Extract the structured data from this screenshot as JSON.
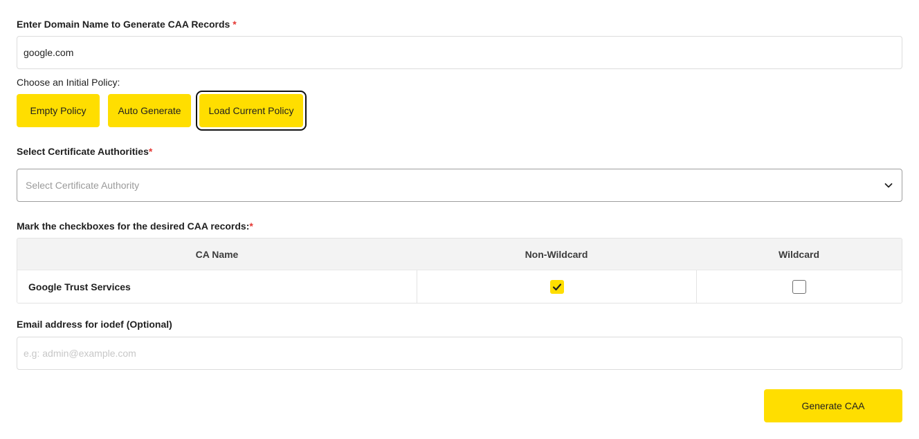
{
  "domain": {
    "label": "Enter Domain Name to Generate CAA Records",
    "required_mark": "*",
    "value": "google.com"
  },
  "policy": {
    "label": "Choose an Initial Policy:",
    "buttons": [
      {
        "label": "Empty Policy",
        "selected": false
      },
      {
        "label": "Auto Generate",
        "selected": false
      },
      {
        "label": "Load Current Policy",
        "selected": true
      }
    ]
  },
  "ca_select": {
    "label": "Select Certificate Authorities",
    "required_mark": "*",
    "placeholder": "Select Certificate Authority",
    "icon": "chevron-down-icon"
  },
  "records": {
    "label": "Mark the checkboxes for the desired CAA records:",
    "required_mark": "*",
    "columns": [
      "CA Name",
      "Non-Wildcard",
      "Wildcard"
    ],
    "rows": [
      {
        "ca_name": "Google Trust Services",
        "non_wildcard": true,
        "wildcard": false
      }
    ]
  },
  "iodef": {
    "label": "Email address for iodef (Optional)",
    "placeholder": "e.g: admin@example.com",
    "value": ""
  },
  "generate": {
    "label": "Generate CAA"
  },
  "colors": {
    "accent": "#ffde00",
    "required": "#e53935",
    "border": "#dcdcdc",
    "table_header_bg": "#f3f3f3"
  }
}
